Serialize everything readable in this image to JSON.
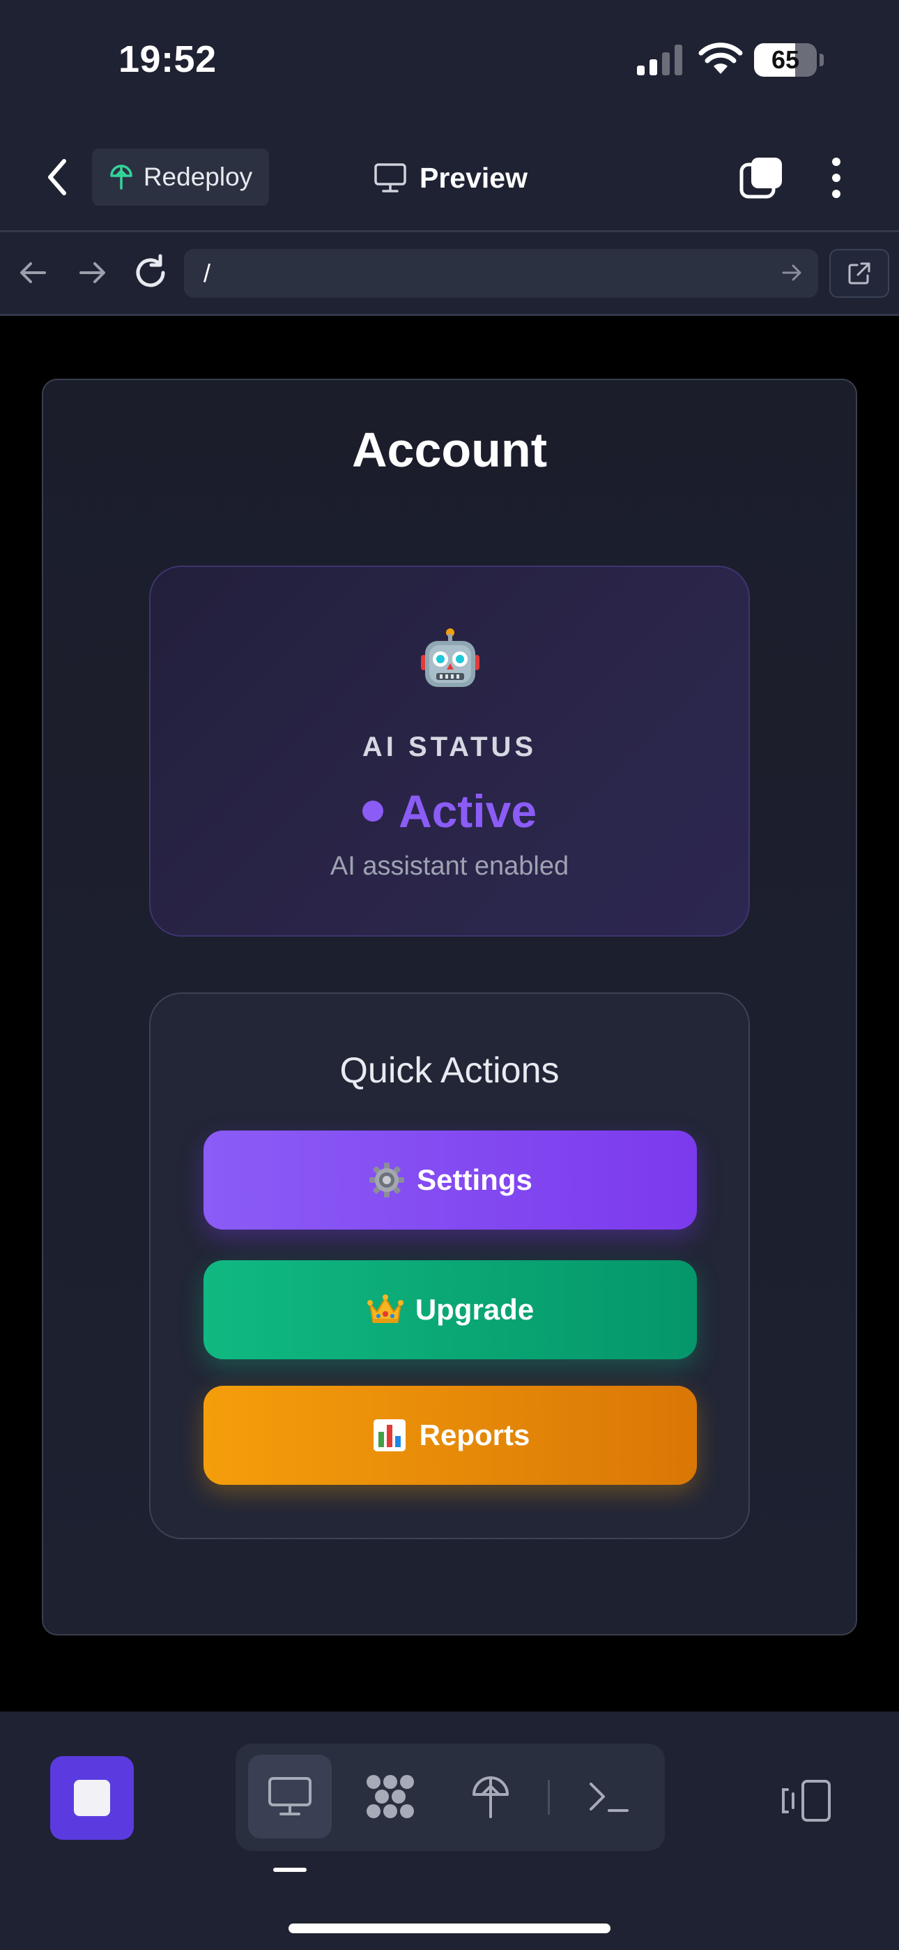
{
  "status_bar": {
    "time": "19:52",
    "battery": "65",
    "battery_level": 0.65
  },
  "header": {
    "redeploy_label": "Redeploy",
    "title": "Preview"
  },
  "url_bar": {
    "value": "/"
  },
  "page": {
    "title": "Account",
    "ai_card": {
      "icon": "robot-icon",
      "label": "AI STATUS",
      "status": "Active",
      "status_color": "#8b5cf6",
      "description": "AI assistant enabled"
    },
    "quick_actions": {
      "title": "Quick Actions",
      "buttons": [
        {
          "label": "Settings",
          "icon": "gear-icon",
          "color": "#8b5cf6"
        },
        {
          "label": "Upgrade",
          "icon": "crown-icon",
          "color": "#10b981"
        },
        {
          "label": "Reports",
          "icon": "bar-chart-icon",
          "color": "#f59e0b"
        }
      ]
    }
  },
  "bottom_toolbar": {
    "tools": [
      {
        "icon": "desktop-icon",
        "active": true
      },
      {
        "icon": "nodes-icon",
        "active": false
      },
      {
        "icon": "deploy-icon",
        "active": false
      },
      {
        "icon": "terminal-icon",
        "active": false
      }
    ],
    "accent": "#5b3be0"
  }
}
